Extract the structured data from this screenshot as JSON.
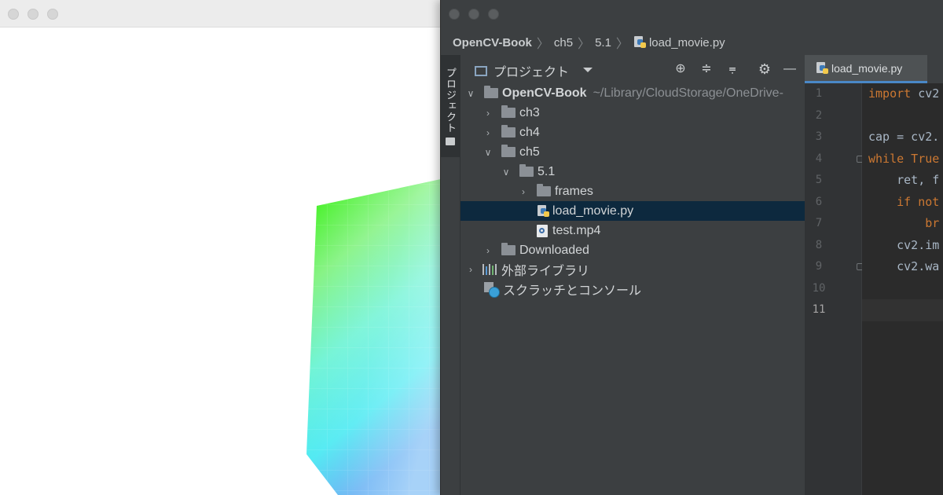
{
  "breadcrumb": {
    "project": "OpenCV-Book",
    "folder": "ch5",
    "subfolder": "5.1",
    "file": "load_movie.py"
  },
  "side_tool_window": {
    "label": "プロジェクト"
  },
  "project_panel": {
    "title": "プロジェクト",
    "toolbar_icons": [
      "locate-icon",
      "expand-all-icon",
      "collapse-all-icon",
      "gear-icon",
      "minimize-icon"
    ]
  },
  "tree": {
    "root": {
      "label": "OpenCV-Book",
      "path_hint": "~/Library/CloudStorage/OneDrive-"
    },
    "items": [
      {
        "label": "ch3"
      },
      {
        "label": "ch4"
      },
      {
        "label": "ch5"
      },
      {
        "label": "5.1"
      },
      {
        "label": "frames"
      },
      {
        "label": "load_movie.py"
      },
      {
        "label": "test.mp4"
      },
      {
        "label": "Downloaded"
      },
      {
        "label": "外部ライブラリ"
      },
      {
        "label": "スクラッチとコンソール"
      }
    ]
  },
  "editor": {
    "tab_label": "load_movie.py",
    "line_numbers": [
      "1",
      "2",
      "3",
      "4",
      "5",
      "6",
      "7",
      "8",
      "9",
      "10",
      "11"
    ],
    "current_line": "11",
    "code": {
      "l1_kw": "import",
      "l1_rest": " cv2",
      "l3": "cap = cv2.",
      "l4_kw": "while",
      "l4_rest": " True",
      "l5": "    ret, f",
      "l6_kw": "    if",
      "l6_rest": " not",
      "l7_kw": "        br",
      "l8": "    cv2.im",
      "l9": "    cv2.wa"
    }
  },
  "colors": {
    "ide_bg": "#3c3f41",
    "editor_bg": "#2b2b2b",
    "selection": "#0d293e",
    "keyword": "#cc7832"
  }
}
